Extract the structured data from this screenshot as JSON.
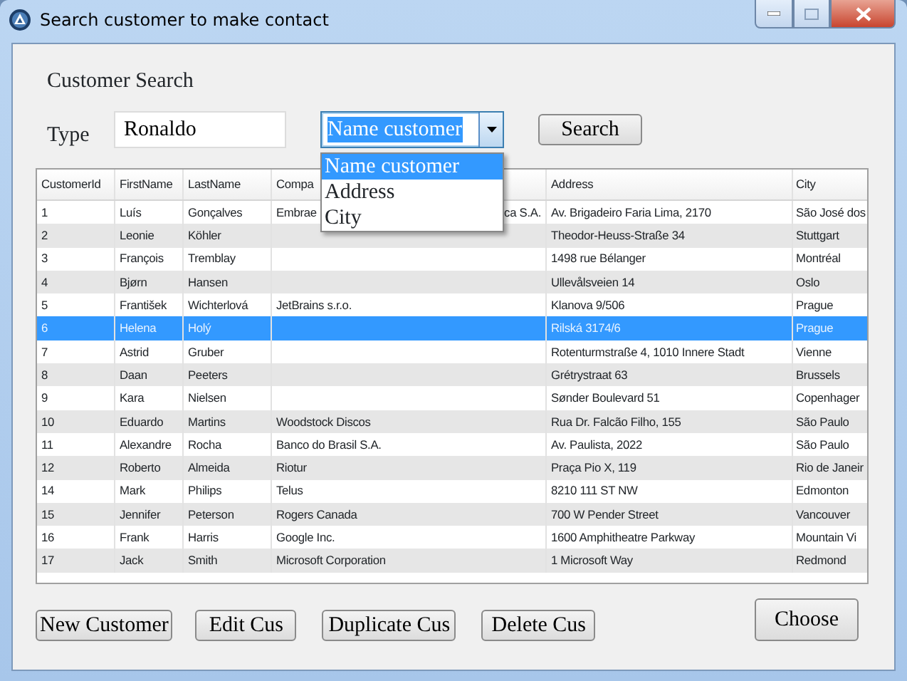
{
  "window": {
    "title": "Search customer to make contact"
  },
  "heading": "Customer Search",
  "type_label": "Type",
  "search_field": {
    "value": "Ronaldo"
  },
  "search_by": {
    "value": "Name customer",
    "expanded": true,
    "options": [
      {
        "label": "Name customer",
        "selected": true
      },
      {
        "label": "Address",
        "selected": false
      },
      {
        "label": "City",
        "selected": false
      }
    ]
  },
  "search_button": "Search",
  "table": {
    "columns": [
      "CustomerId",
      "FirstName",
      "LastName",
      "Compa",
      "Address",
      "City"
    ],
    "rows": [
      {
        "cells": [
          "1",
          "Luís",
          "Gonçalves",
          "Embrae",
          "Av. Brigadeiro Faria Lima, 2170",
          "São José dos"
        ],
        "company_tail": "ca S.A.",
        "selected": false
      },
      {
        "cells": [
          "2",
          "Leonie",
          "Köhler",
          "",
          "Theodor-Heuss-Straße 34",
          "Stuttgart"
        ],
        "selected": false
      },
      {
        "cells": [
          "3",
          "François",
          "Tremblay",
          "",
          "1498 rue Bélanger",
          "Montréal"
        ],
        "selected": false
      },
      {
        "cells": [
          "4",
          "Bjørn",
          "Hansen",
          "",
          "Ullevålsveien 14",
          "Oslo"
        ],
        "selected": false
      },
      {
        "cells": [
          "5",
          "František",
          "Wichterlová",
          "JetBrains s.r.o.",
          "Klanova 9/506",
          "Prague"
        ],
        "selected": false
      },
      {
        "cells": [
          "6",
          "Helena",
          "Holý",
          "",
          "Rilská 3174/6",
          "Prague"
        ],
        "selected": true
      },
      {
        "cells": [
          "7",
          "Astrid",
          "Gruber",
          "",
          "Rotenturmstraße 4, 1010 Innere Stadt",
          "Vienne"
        ],
        "selected": false
      },
      {
        "cells": [
          "8",
          "Daan",
          "Peeters",
          "",
          "Grétrystraat 63",
          "Brussels"
        ],
        "selected": false
      },
      {
        "cells": [
          "9",
          "Kara",
          "Nielsen",
          "",
          "Sønder Boulevard 51",
          "Copenhager"
        ],
        "selected": false
      },
      {
        "cells": [
          "10",
          "Eduardo",
          "Martins",
          "Woodstock Discos",
          "Rua Dr. Falcão Filho, 155",
          "São Paulo"
        ],
        "selected": false
      },
      {
        "cells": [
          "11",
          "Alexandre",
          "Rocha",
          "Banco do Brasil S.A.",
          "Av. Paulista, 2022",
          "São Paulo"
        ],
        "selected": false
      },
      {
        "cells": [
          "12",
          "Roberto",
          "Almeida",
          "Riotur",
          "Praça Pio X, 119",
          "Rio de Janeir"
        ],
        "selected": false
      },
      {
        "cells": [
          "14",
          "Mark",
          "Philips",
          "Telus",
          "8210 111 ST NW",
          "Edmonton"
        ],
        "selected": false
      },
      {
        "cells": [
          "15",
          "Jennifer",
          "Peterson",
          "Rogers Canada",
          "700 W Pender Street",
          "Vancouver"
        ],
        "selected": false
      },
      {
        "cells": [
          "16",
          "Frank",
          "Harris",
          "Google Inc.",
          "1600 Amphitheatre Parkway",
          "Mountain Vi"
        ],
        "selected": false
      },
      {
        "cells": [
          "17",
          "Jack",
          "Smith",
          "Microsoft Corporation",
          "1 Microsoft Way",
          "Redmond"
        ],
        "selected": false
      }
    ]
  },
  "buttons": [
    "New Customer",
    "Edit Cus",
    "Duplicate Cus",
    "Delete Cus"
  ],
  "choose_button": "Choose"
}
